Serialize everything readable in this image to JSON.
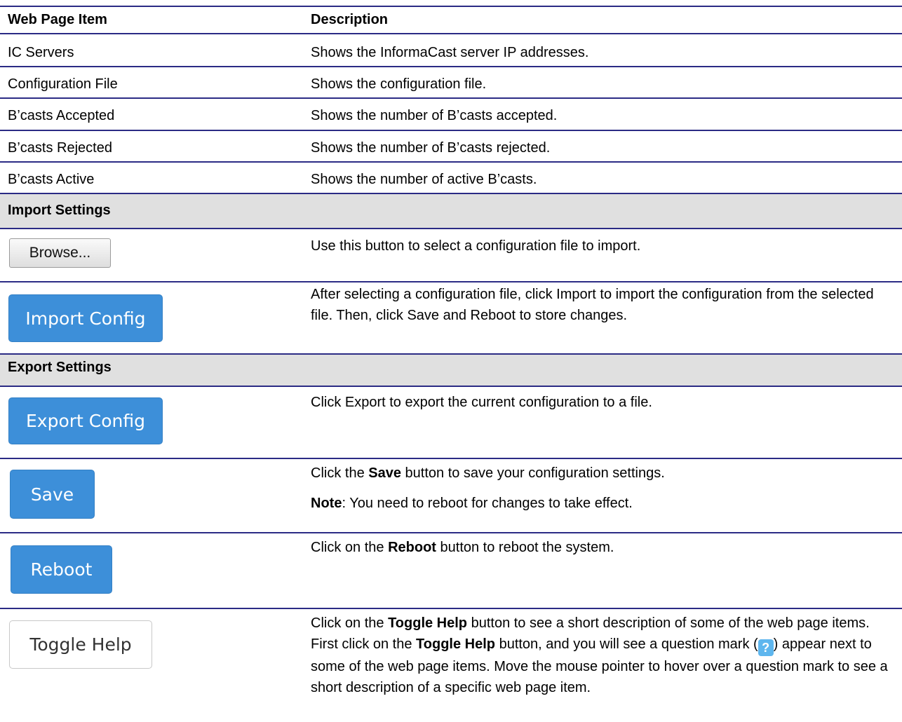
{
  "header": {
    "item": "Web Page Item",
    "desc": "Description"
  },
  "rows": [
    {
      "item": "IC Servers",
      "desc": "Shows the InformaCast server IP addresses."
    },
    {
      "item": "Configuration File",
      "desc": "Shows the configuration file."
    },
    {
      "item": "B’casts Accepted",
      "desc": "Shows the number of B’casts accepted."
    },
    {
      "item": "B’casts Rejected",
      "desc": "Shows the number of B’casts rejected."
    },
    {
      "item": "B’casts Active",
      "desc": "Shows the number of active B’casts."
    }
  ],
  "import_section": {
    "title": "Import Settings",
    "browse_label": "Browse...",
    "browse_desc": "Use this button to select a configuration file to import.",
    "import_label": "Import Config",
    "import_desc": "After selecting a configuration file, click Import to import the configuration from the selected file. Then, click Save and Reboot to store changes."
  },
  "export_section": {
    "title": "Export Settings",
    "export_label": "Export Config",
    "export_desc": "Click Export to export the current configuration to a file."
  },
  "save": {
    "label": "Save",
    "desc_pre": "Click the ",
    "desc_bold": "Save",
    "desc_post": " button to save your configuration settings.",
    "note_bold": "Note",
    "note_text": ": You need to reboot for changes to take effect."
  },
  "reboot": {
    "label": "Reboot",
    "desc_pre": "Click on the ",
    "desc_bold": "Reboot",
    "desc_post": " button to reboot the system."
  },
  "toggle": {
    "label": "Toggle Help",
    "p1": "Click on the ",
    "b1": "Toggle Help",
    "p2": " button to see a short description of some of the web page items. First click on the ",
    "b2": "Toggle Help",
    "p3": " button, and you will see a question mark (",
    "icon_glyph": "?",
    "p4": ") appear next to some of the web page items. Move the mouse pointer to hover over a question mark to see a short description of a specific web page item."
  },
  "icon_names": [
    "question-mark-icon"
  ],
  "colors": {
    "rule": "#2b2b85",
    "section_bg": "#e0e0e0",
    "button_blue": "#3d8fd9",
    "icon_blue": "#5eb6ee"
  }
}
